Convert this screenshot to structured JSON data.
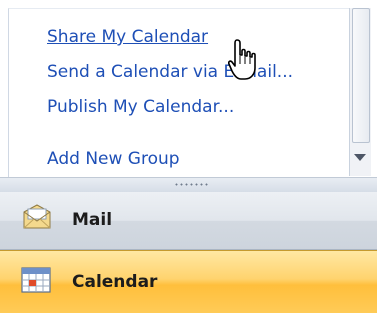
{
  "links": [
    {
      "label": "Share My Calendar",
      "hover": true
    },
    {
      "label": "Send a Calendar via E-mail..."
    },
    {
      "label": "Publish My Calendar..."
    },
    {
      "label": "Add New Group"
    }
  ],
  "nav": {
    "mail_label": "Mail",
    "calendar_label": "Calendar",
    "mail_icon": "mail-icon",
    "calendar_icon": "calendar-icon"
  },
  "colors": {
    "link": "#1e4fb6",
    "selected_nav": "#ffc44d"
  }
}
